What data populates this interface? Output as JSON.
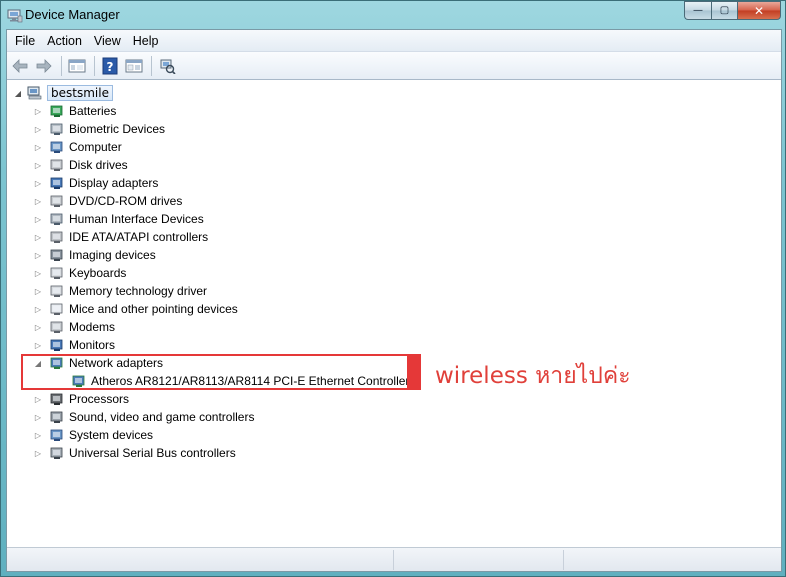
{
  "window": {
    "title": "Device Manager",
    "minimize_glyph": "—",
    "maximize_glyph": "▢",
    "close_glyph": "✕"
  },
  "menu": [
    {
      "label": "File"
    },
    {
      "label": "Action"
    },
    {
      "label": "View"
    },
    {
      "label": "Help"
    }
  ],
  "toolbar": {
    "icons": [
      "back-icon",
      "forward-icon",
      "show-hide-console-tree-icon",
      "help-icon",
      "properties-icon",
      "scan-hardware-icon"
    ]
  },
  "tree": {
    "root_label": "bestsmile",
    "categories": [
      {
        "label": "Batteries",
        "icon": "battery-icon"
      },
      {
        "label": "Biometric Devices",
        "icon": "biometric-icon"
      },
      {
        "label": "Computer",
        "icon": "computer-icon"
      },
      {
        "label": "Disk drives",
        "icon": "disk-drive-icon"
      },
      {
        "label": "Display adapters",
        "icon": "display-adapter-icon"
      },
      {
        "label": "DVD/CD-ROM drives",
        "icon": "dvd-drive-icon"
      },
      {
        "label": "Human Interface Devices",
        "icon": "hid-icon"
      },
      {
        "label": "IDE ATA/ATAPI controllers",
        "icon": "ide-controller-icon"
      },
      {
        "label": "Imaging devices",
        "icon": "imaging-device-icon"
      },
      {
        "label": "Keyboards",
        "icon": "keyboard-icon"
      },
      {
        "label": "Memory technology driver",
        "icon": "memory-icon"
      },
      {
        "label": "Mice and other pointing devices",
        "icon": "mouse-icon"
      },
      {
        "label": "Modems",
        "icon": "modem-icon"
      },
      {
        "label": "Monitors",
        "icon": "monitor-icon"
      },
      {
        "label": "Network adapters",
        "icon": "network-adapter-icon",
        "expanded": true,
        "children": [
          {
            "label": "Atheros AR8121/AR8113/AR8114 PCI-E Ethernet Controller",
            "icon": "network-card-icon"
          }
        ]
      },
      {
        "label": "Processors",
        "icon": "processor-icon"
      },
      {
        "label": "Sound, video and game controllers",
        "icon": "sound-icon"
      },
      {
        "label": "System devices",
        "icon": "system-device-icon"
      },
      {
        "label": "Universal Serial Bus controllers",
        "icon": "usb-icon"
      }
    ]
  },
  "annotation": {
    "text": "wireless หายไปค่ะ",
    "color": "#e0403a"
  },
  "colors": {
    "highlight_border": "#e53838",
    "selection_bg": "#d8e8f8"
  }
}
